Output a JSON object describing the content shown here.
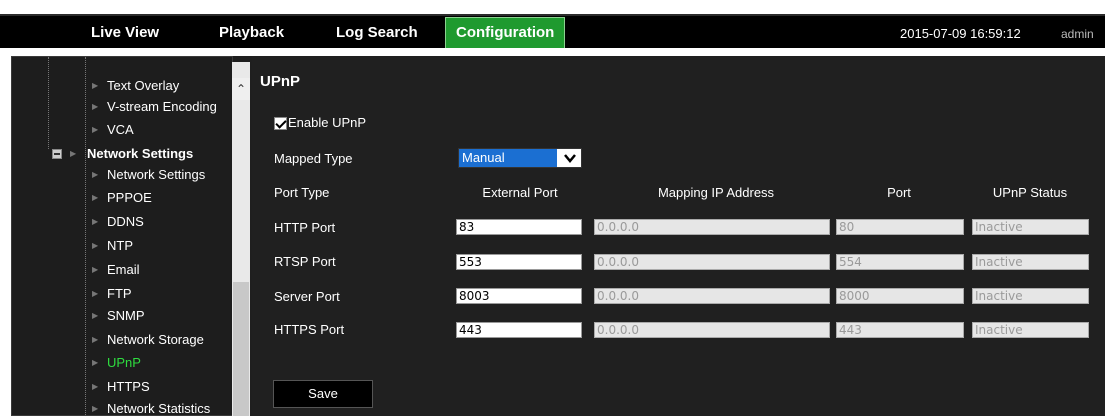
{
  "nav": {
    "items": [
      "Live View",
      "Playback",
      "Log Search",
      "Configuration"
    ],
    "active": "Configuration",
    "datetime": "2015-07-09 16:59:12",
    "user": "admin"
  },
  "sidebar": {
    "items": [
      {
        "label": "Text Overlay"
      },
      {
        "label": "V-stream Encoding"
      },
      {
        "label": "VCA"
      },
      {
        "label": "Network Settings"
      },
      {
        "label": "Network Settings"
      },
      {
        "label": "PPPOE"
      },
      {
        "label": "DDNS"
      },
      {
        "label": "NTP"
      },
      {
        "label": "Email"
      },
      {
        "label": "FTP"
      },
      {
        "label": "SNMP"
      },
      {
        "label": "Network Storage"
      },
      {
        "label": "UPnP"
      },
      {
        "label": "HTTPS"
      },
      {
        "label": "Network Statistics"
      }
    ]
  },
  "main": {
    "title": "UPnP",
    "enable_label": "Enable UPnP",
    "enable_checked": true,
    "mapped_type_label": "Mapped Type",
    "mapped_type_value": "Manual",
    "headers": [
      "Port Type",
      "External Port",
      "Mapping IP Address",
      "Port",
      "UPnP Status"
    ],
    "rows": [
      {
        "type": "HTTP Port",
        "external": "83",
        "ip": "0.0.0.0",
        "port": "80",
        "status": "Inactive"
      },
      {
        "type": "RTSP Port",
        "external": "553",
        "ip": "0.0.0.0",
        "port": "554",
        "status": "Inactive"
      },
      {
        "type": "Server Port",
        "external": "8003",
        "ip": "0.0.0.0",
        "port": "8000",
        "status": "Inactive"
      },
      {
        "type": "HTTPS Port",
        "external": "443",
        "ip": "0.0.0.0",
        "port": "443",
        "status": "Inactive"
      }
    ],
    "save_label": "Save"
  },
  "colors": {
    "active_tab": "#1f9a2f",
    "active_tree_item": "#2edc3f",
    "select_highlight": "#1b6fd2"
  }
}
